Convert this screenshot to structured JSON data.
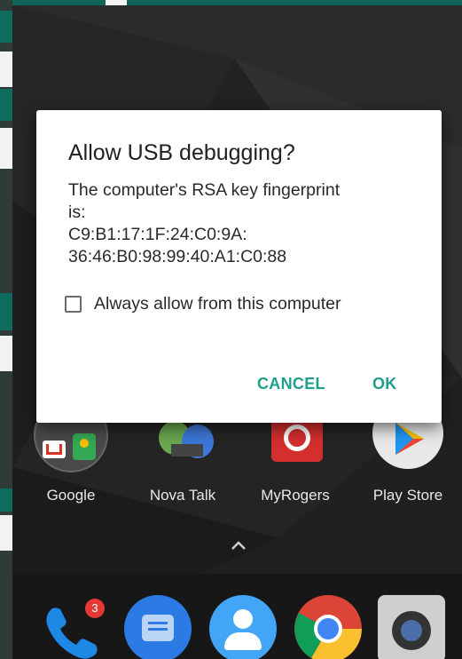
{
  "dialog": {
    "title": "Allow USB debugging?",
    "message_line1": "The computer's RSA key fingerprint",
    "message_line2": "is:",
    "fingerprint_line1": "C9:B1:17:1F:24:C0:9A:",
    "fingerprint_line2": "36:46:B0:98:99:40:A1:C0:88",
    "checkbox_label": "Always allow from this computer",
    "checkbox_checked": false,
    "cancel_label": "CANCEL",
    "ok_label": "OK"
  },
  "home_apps": [
    {
      "label": "Google",
      "icon": "google-folder-icon"
    },
    {
      "label": "Nova Talk",
      "icon": "nova-talk-icon"
    },
    {
      "label": "MyRogers",
      "icon": "myrogers-icon"
    },
    {
      "label": "Play Store",
      "icon": "play-store-icon"
    }
  ],
  "dock": {
    "phone_badge": "3",
    "icons": [
      "phone-icon",
      "messages-icon",
      "contacts-icon",
      "chrome-icon",
      "camera-icon"
    ]
  },
  "colors": {
    "accent": "#1f9e8b",
    "dialog_bg": "#ffffff",
    "badge": "#e53935"
  }
}
